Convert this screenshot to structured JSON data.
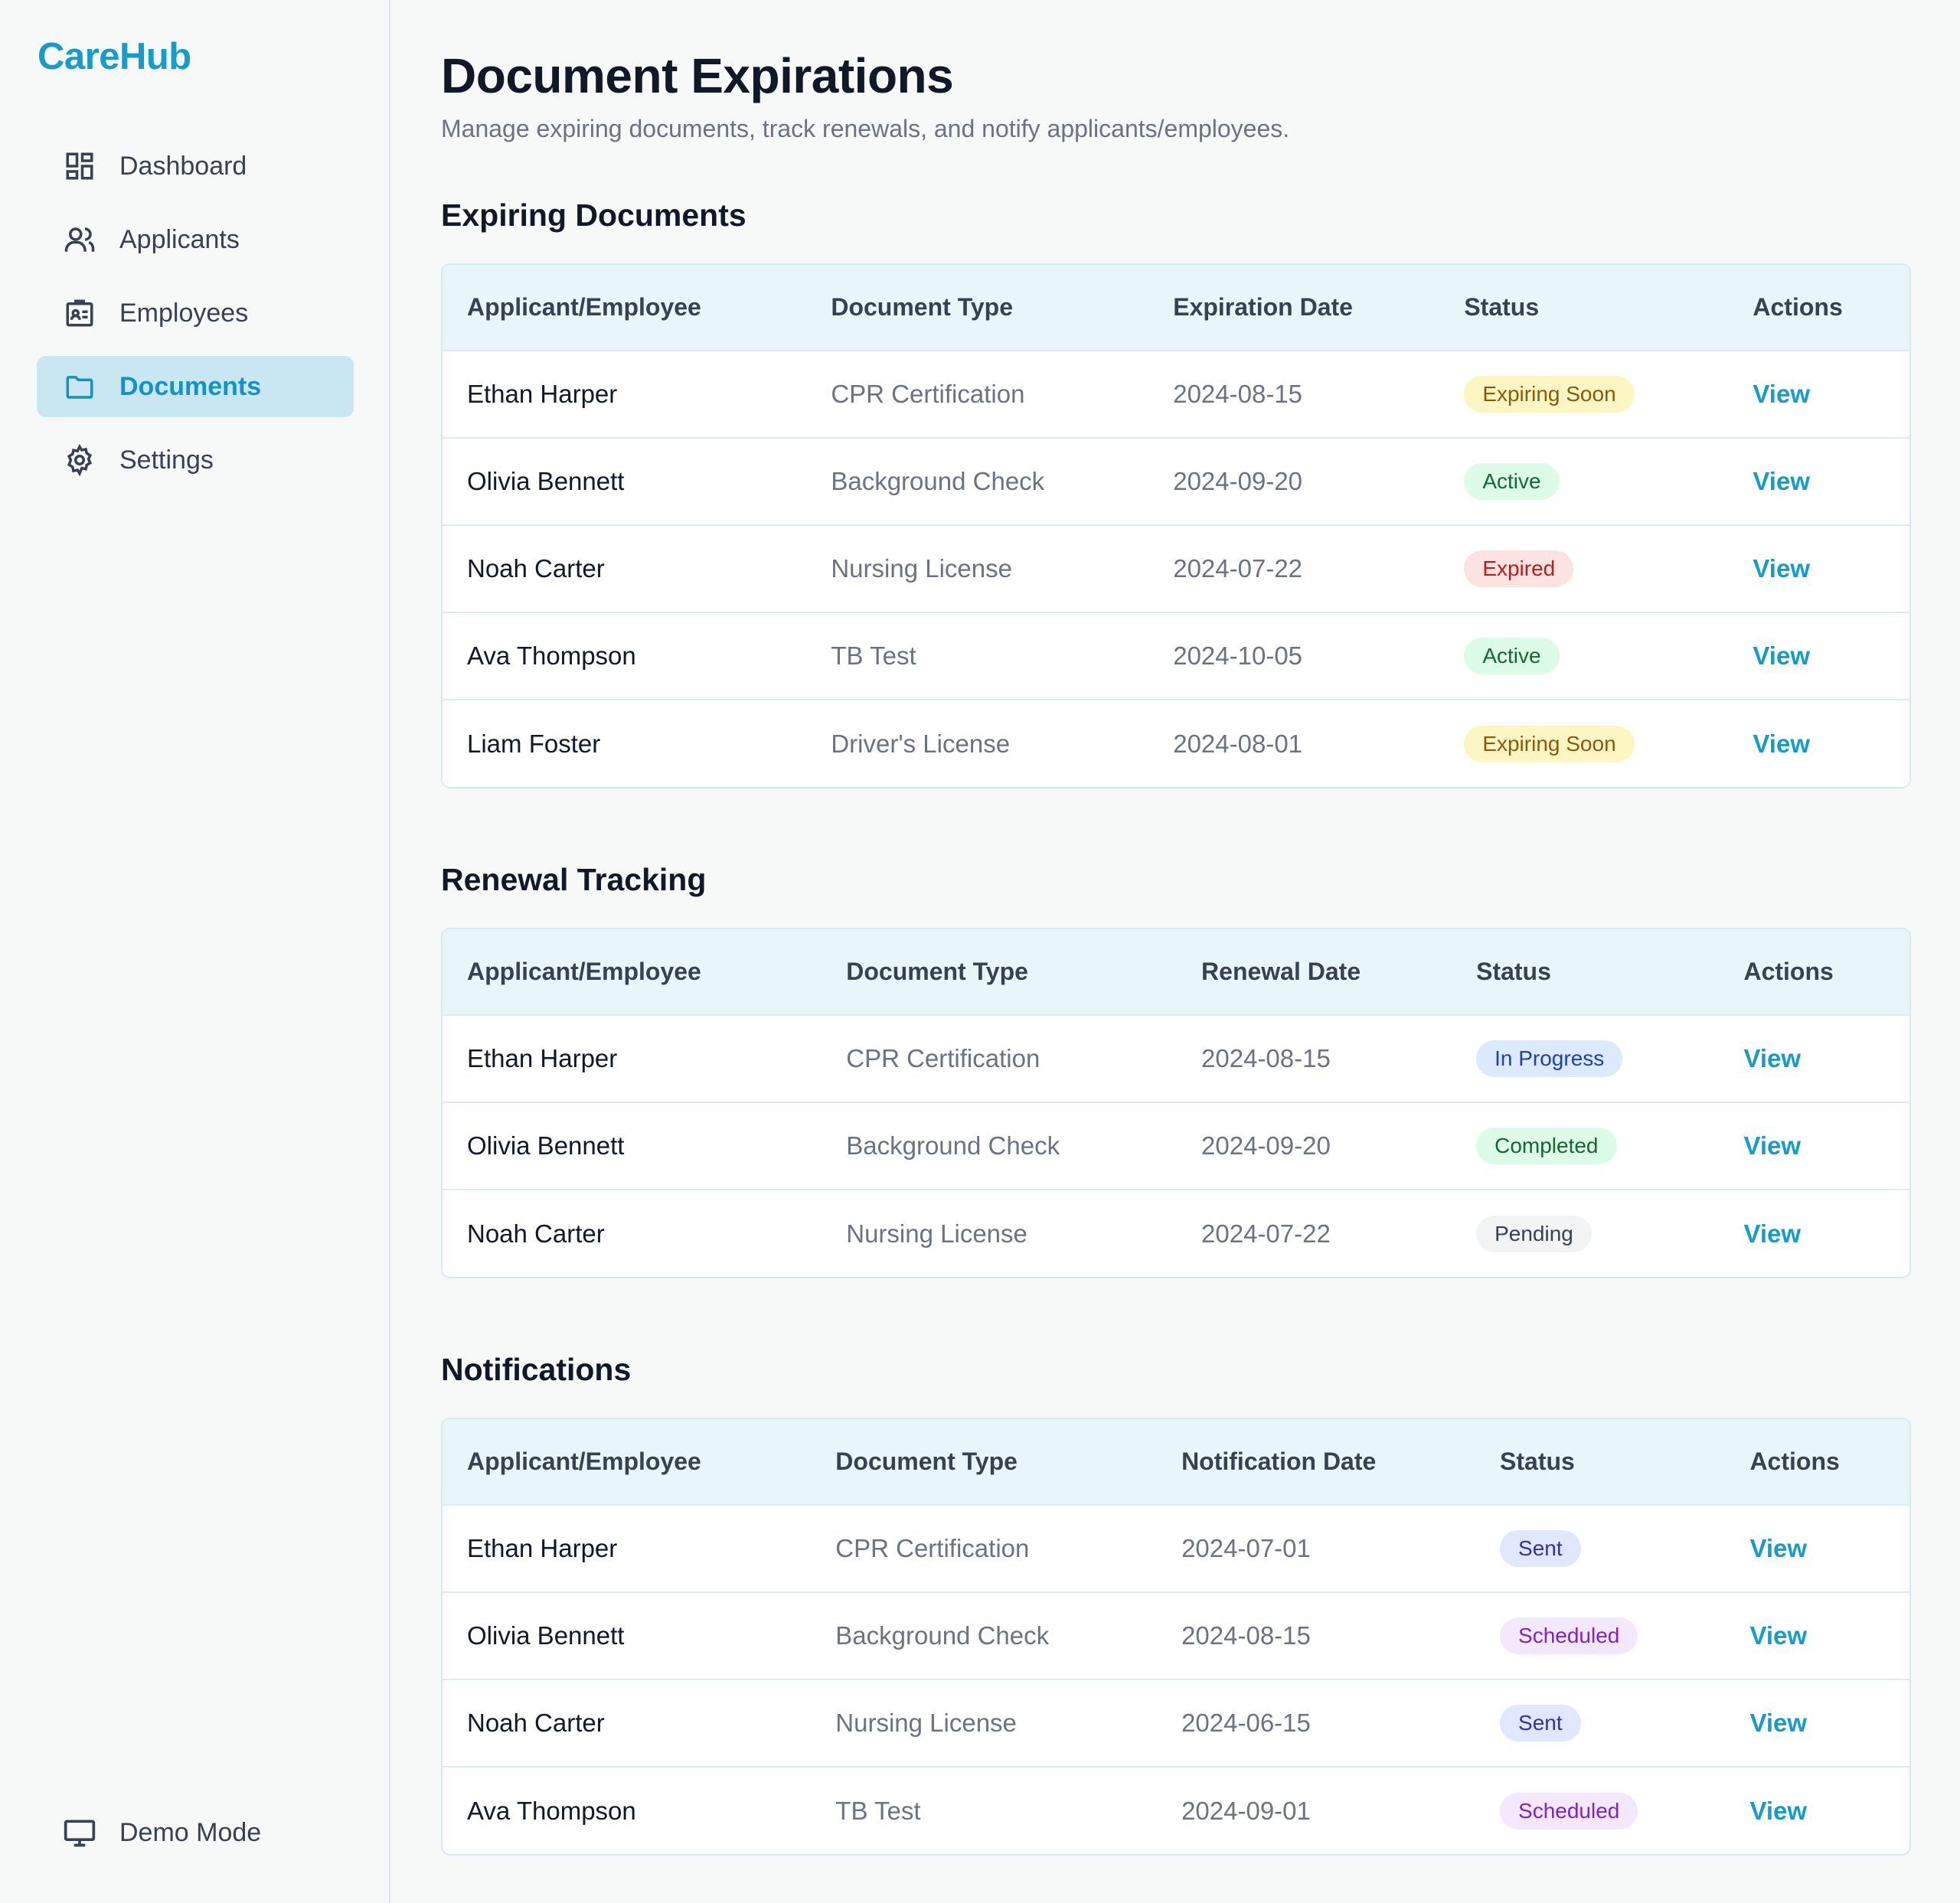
{
  "brand": "CareHub",
  "nav": [
    {
      "label": "Dashboard",
      "icon": "dashboard-icon",
      "active": false
    },
    {
      "label": "Applicants",
      "icon": "users-icon",
      "active": false
    },
    {
      "label": "Employees",
      "icon": "id-badge-icon",
      "active": false
    },
    {
      "label": "Documents",
      "icon": "folder-icon",
      "active": true
    },
    {
      "label": "Settings",
      "icon": "gear-icon",
      "active": false
    }
  ],
  "footer": {
    "label": "Demo Mode",
    "icon": "monitor-icon"
  },
  "header": {
    "title": "Document Expirations",
    "subtitle": "Manage expiring documents, track renewals, and notify applicants/employees."
  },
  "status_colors": {
    "Expiring Soon": {
      "bg": "#fdf6c3",
      "fg": "#8a5a0a"
    },
    "Active": {
      "bg": "#dcfce7",
      "fg": "#166534"
    },
    "Expired": {
      "bg": "#fde2e2",
      "fg": "#b91c1c"
    },
    "In Progress": {
      "bg": "#dbeafe",
      "fg": "#1e40af"
    },
    "Completed": {
      "bg": "#dcfce7",
      "fg": "#166534"
    },
    "Pending": {
      "bg": "#f1f3f5",
      "fg": "#374151"
    },
    "Sent": {
      "bg": "#e0e7ff",
      "fg": "#3730a3"
    },
    "Scheduled": {
      "bg": "#f3e8ff",
      "fg": "#7e22ce"
    }
  },
  "sections": [
    {
      "title": "Expiring Documents",
      "columns": [
        "Applicant/Employee",
        "Document Type",
        "Expiration Date",
        "Status",
        "Actions"
      ],
      "rows": [
        {
          "name": "Ethan Harper",
          "doc": "CPR Certification",
          "date": "2024-08-15",
          "status": "Expiring Soon",
          "action": "View"
        },
        {
          "name": "Olivia Bennett",
          "doc": "Background Check",
          "date": "2024-09-20",
          "status": "Active",
          "action": "View"
        },
        {
          "name": "Noah Carter",
          "doc": "Nursing License",
          "date": "2024-07-22",
          "status": "Expired",
          "action": "View"
        },
        {
          "name": "Ava Thompson",
          "doc": "TB Test",
          "date": "2024-10-05",
          "status": "Active",
          "action": "View"
        },
        {
          "name": "Liam Foster",
          "doc": "Driver's License",
          "date": "2024-08-01",
          "status": "Expiring Soon",
          "action": "View"
        }
      ]
    },
    {
      "title": "Renewal Tracking",
      "columns": [
        "Applicant/Employee",
        "Document Type",
        "Renewal Date",
        "Status",
        "Actions"
      ],
      "rows": [
        {
          "name": "Ethan Harper",
          "doc": "CPR Certification",
          "date": "2024-08-15",
          "status": "In Progress",
          "action": "View"
        },
        {
          "name": "Olivia Bennett",
          "doc": "Background Check",
          "date": "2024-09-20",
          "status": "Completed",
          "action": "View"
        },
        {
          "name": "Noah Carter",
          "doc": "Nursing License",
          "date": "2024-07-22",
          "status": "Pending",
          "action": "View"
        }
      ]
    },
    {
      "title": "Notifications",
      "columns": [
        "Applicant/Employee",
        "Document Type",
        "Notification Date",
        "Status",
        "Actions"
      ],
      "rows": [
        {
          "name": "Ethan Harper",
          "doc": "CPR Certification",
          "date": "2024-07-01",
          "status": "Sent",
          "action": "View"
        },
        {
          "name": "Olivia Bennett",
          "doc": "Background Check",
          "date": "2024-08-15",
          "status": "Scheduled",
          "action": "View"
        },
        {
          "name": "Noah Carter",
          "doc": "Nursing License",
          "date": "2024-06-15",
          "status": "Sent",
          "action": "View"
        },
        {
          "name": "Ava Thompson",
          "doc": "TB Test",
          "date": "2024-09-01",
          "status": "Scheduled",
          "action": "View"
        }
      ]
    }
  ]
}
